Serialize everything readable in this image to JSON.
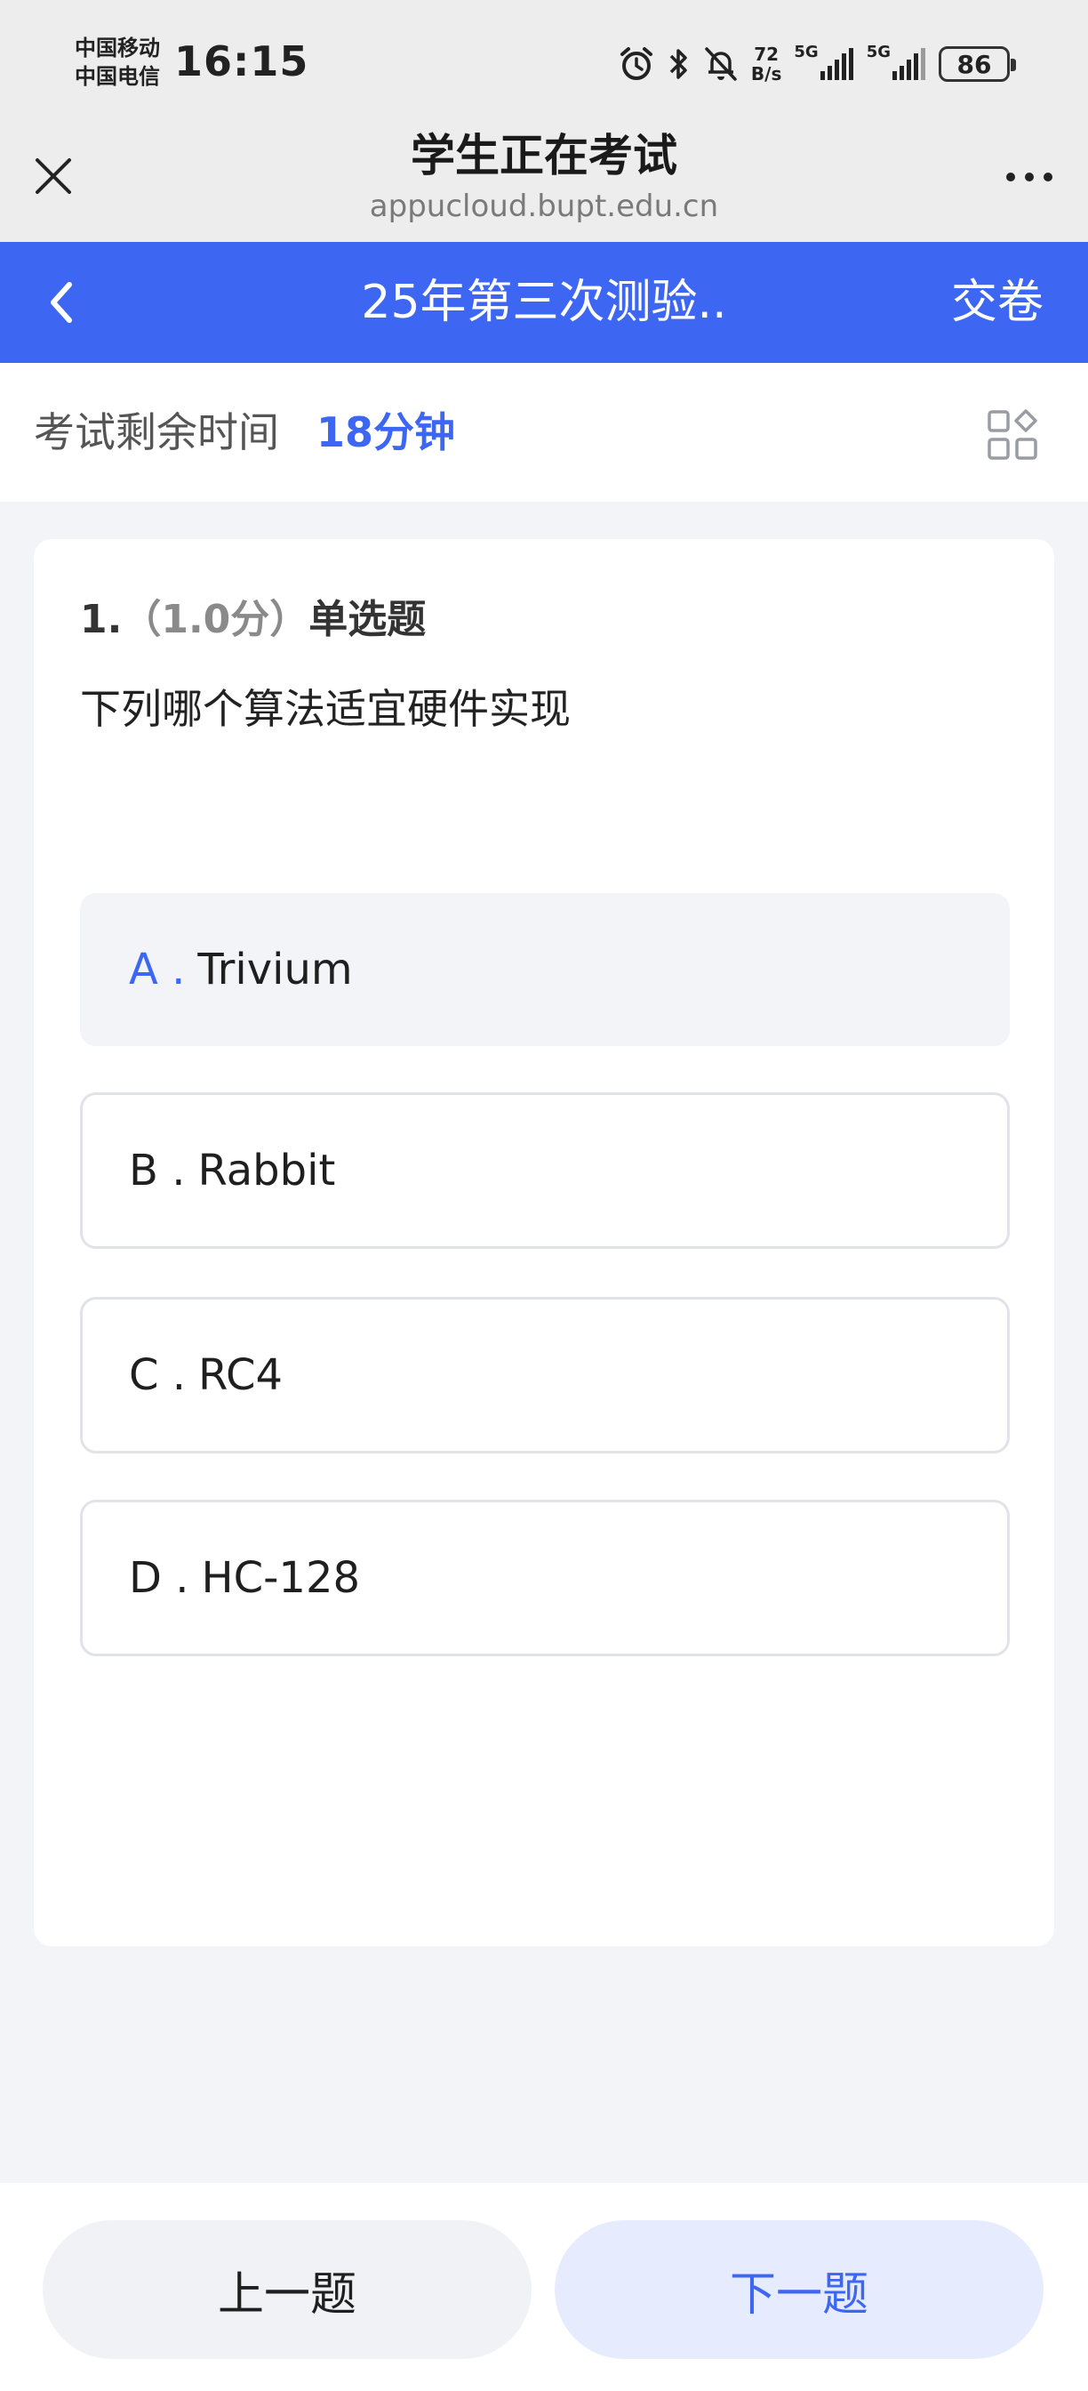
{
  "status_bar": {
    "carrier_1": "中国移动",
    "carrier_2": "中国电信",
    "time": "16:15",
    "net_speed_value": "72",
    "net_speed_unit": "B/s",
    "signal_1_label": "5G",
    "signal_2_label": "5G",
    "battery": "86",
    "icons": [
      "alarm-icon",
      "bluetooth-icon",
      "bell-muted-icon",
      "signal-icon",
      "signal-icon",
      "battery-icon"
    ]
  },
  "browser": {
    "title": "学生正在考试",
    "url": "appucloud.bupt.edu.cn",
    "close_icon": "close-icon",
    "more_icon": "more-icon"
  },
  "exam_header": {
    "title": "25年第三次测验..",
    "submit_label": "交卷",
    "back_icon": "chevron-left-icon"
  },
  "timer": {
    "label": "考试剩余时间",
    "value": "18分钟",
    "grid_icon": "answer-sheet-icon"
  },
  "question": {
    "number": "1.",
    "score": "（1.0分）",
    "type": "单选题",
    "text": "下列哪个算法适宜硬件实现",
    "options": [
      {
        "letter": "A .",
        "text": "Trivium",
        "selected": true
      },
      {
        "letter": "B .",
        "text": "Rabbit",
        "selected": false
      },
      {
        "letter": "C .",
        "text": "RC4",
        "selected": false
      },
      {
        "letter": "D .",
        "text": "HC-128",
        "selected": false
      }
    ]
  },
  "bottom_nav": {
    "prev_label": "上一题",
    "next_label": "下一题"
  },
  "colors": {
    "accent": "#3d67f2",
    "page_background": "#f3f4f8",
    "browser_chrome": "#ededed",
    "next_button_bg": "#e6ecfd"
  }
}
